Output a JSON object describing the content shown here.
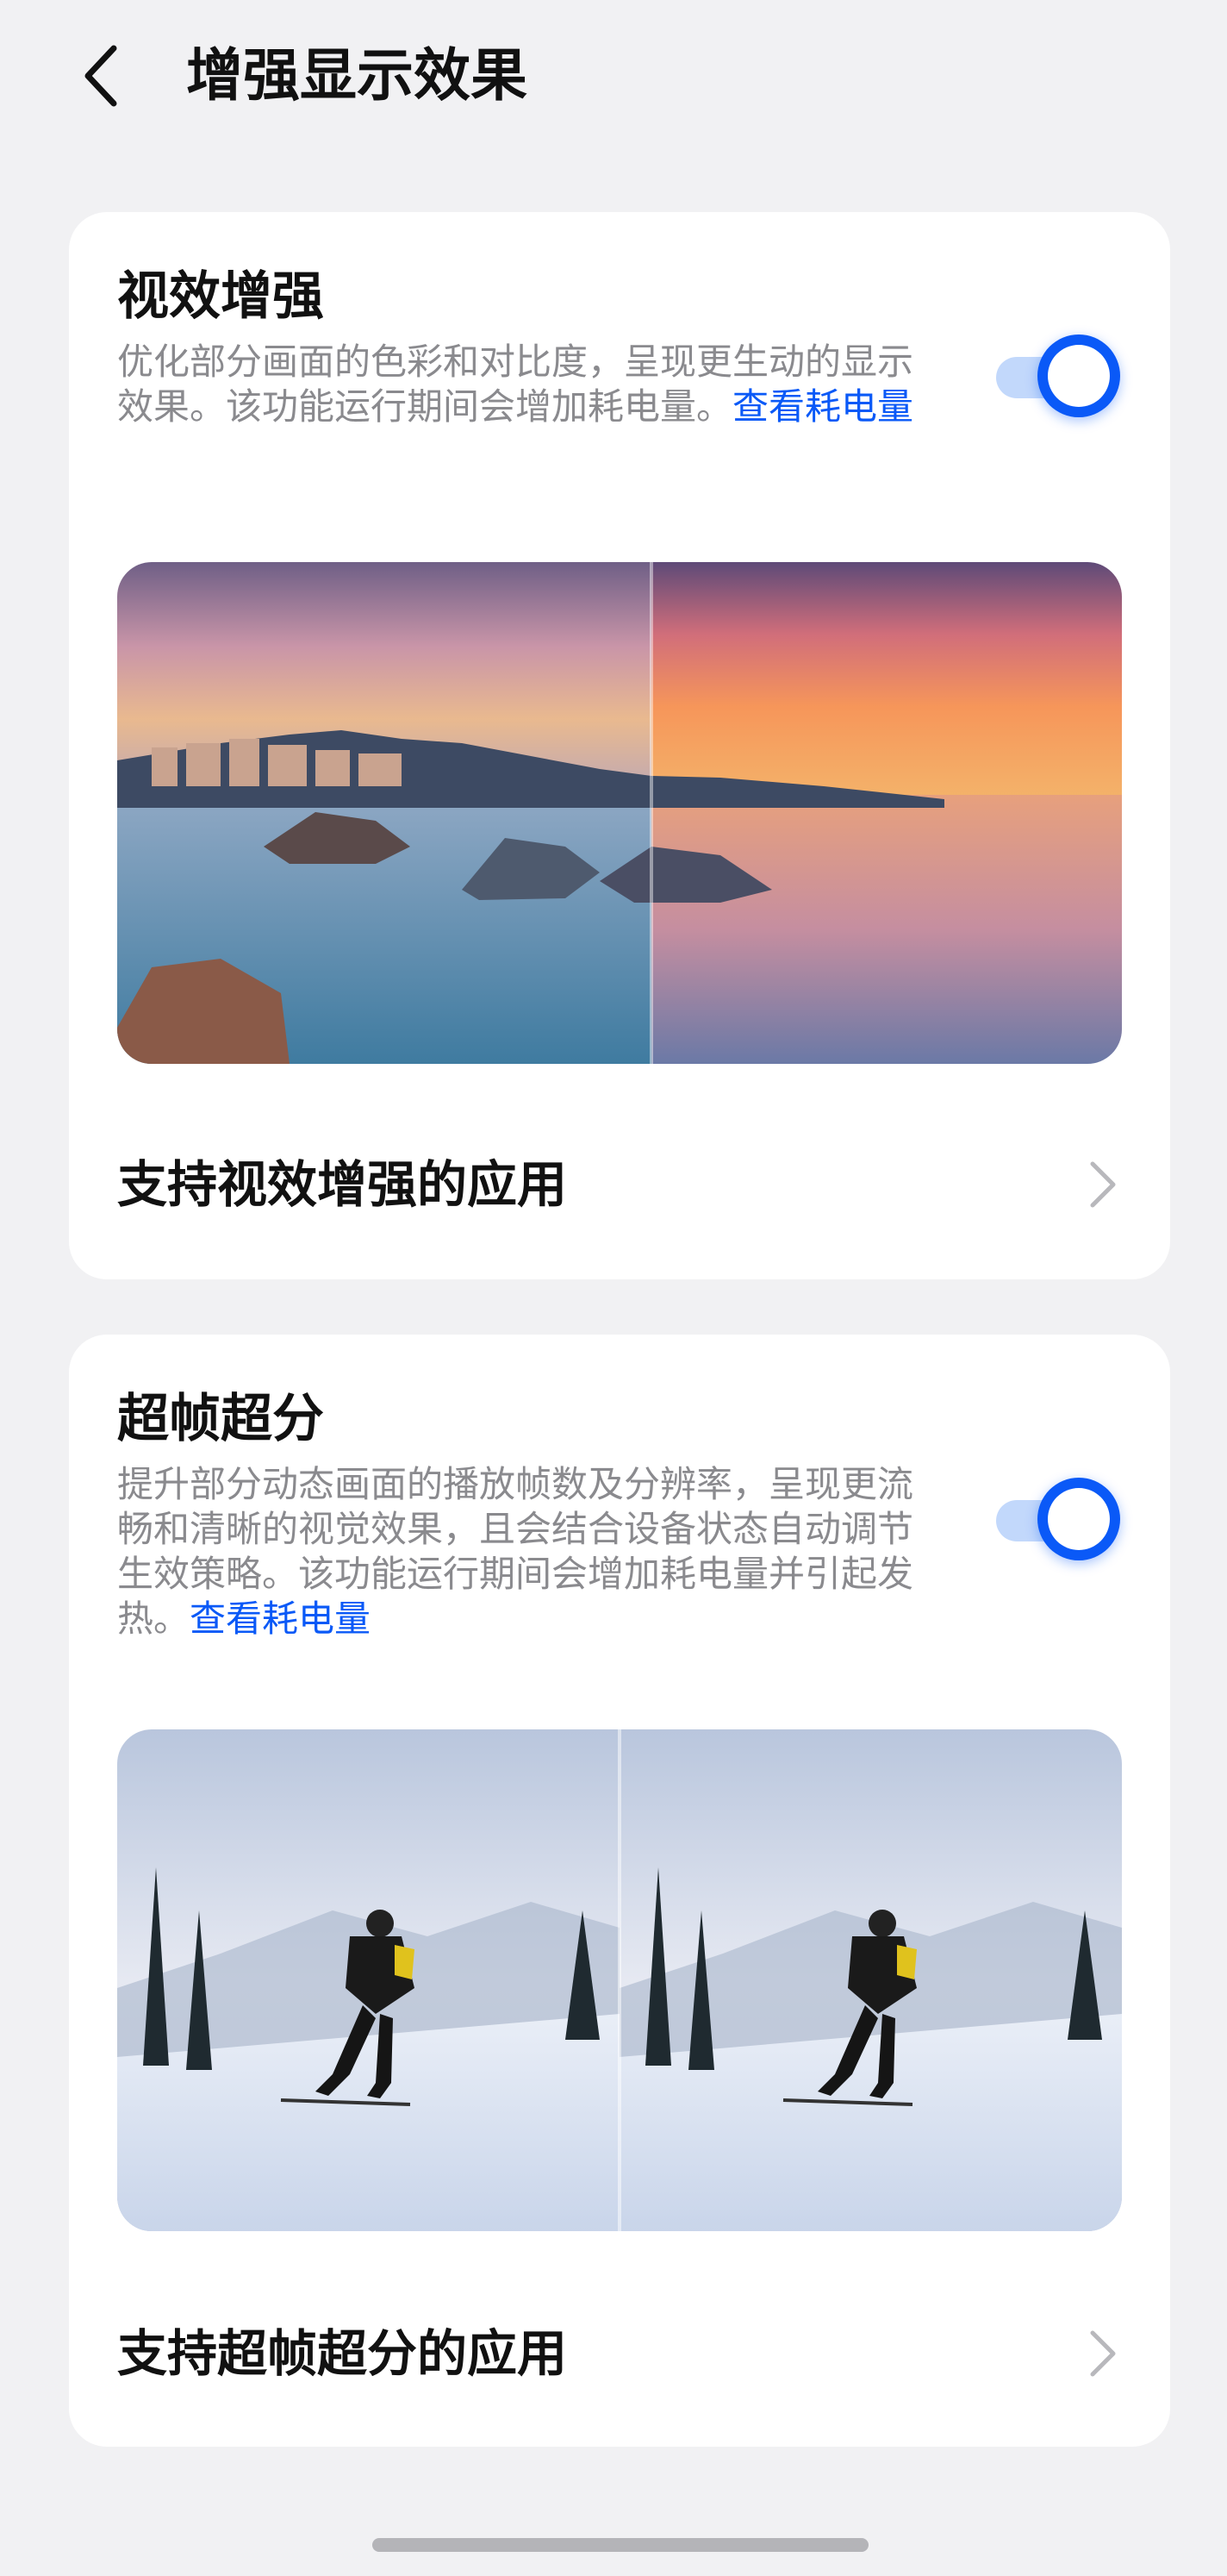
{
  "header": {
    "title": "增强显示效果",
    "back_icon": "back-arrow-icon"
  },
  "colors": {
    "accent": "#0a59f7",
    "toggle_track": "#c2d8fb",
    "background": "#f1f1f3",
    "card": "#ffffff",
    "secondary_text": "#8a8a8e"
  },
  "visual_enhancement": {
    "title": "视效增强",
    "description": "优化部分画面的色彩和对比度，呈现更生动的显示效果。该功能运行期间会增加耗电量。",
    "link": "查看耗电量",
    "toggle_on": true,
    "preview_alt": "seaside-sunset-comparison",
    "apps_row_label": "支持视效增强的应用",
    "chevron_icon": "chevron-right-icon"
  },
  "super_frame": {
    "title": "超帧超分",
    "description": "提升部分动态画面的播放帧数及分辨率，呈现更流畅和清晰的视觉效果，且会结合设备状态自动调节生效策略。该功能运行期间会增加耗电量并引起发热。",
    "link": "查看耗电量",
    "toggle_on": true,
    "preview_alt": "skier-comparison",
    "apps_row_label": "支持超帧超分的应用",
    "chevron_icon": "chevron-right-icon"
  }
}
